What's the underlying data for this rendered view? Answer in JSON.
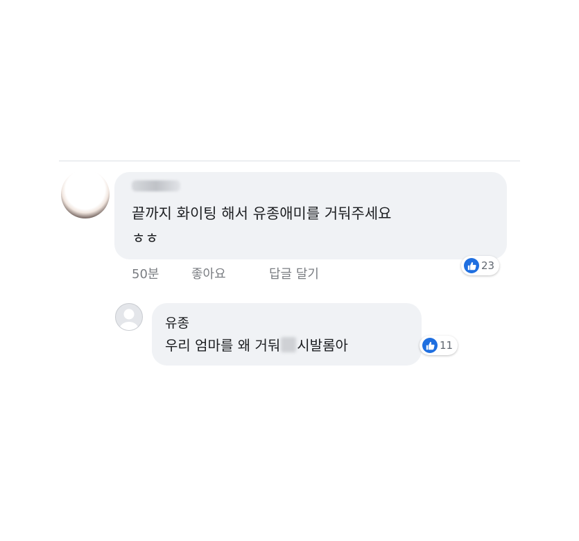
{
  "comment1": {
    "text_line1": "끝까지 화이팅 해서 유종애미를 거둬주세요",
    "text_line2": "ㅎㅎ",
    "time": "50분",
    "like_action": "좋아요",
    "reply_action": "답글 달기",
    "reaction_count": "23"
  },
  "reply1": {
    "author": "유종",
    "text_before": "우리 엄마를 왜 거둬",
    "text_after": "시발롬아",
    "reaction_count": "11"
  },
  "colors": {
    "bubble": "#f0f2f5",
    "like_blue": "#1f6fe0",
    "meta_gray": "#7a7d82"
  },
  "icons": [
    "like-icon",
    "default-avatar-icon"
  ]
}
